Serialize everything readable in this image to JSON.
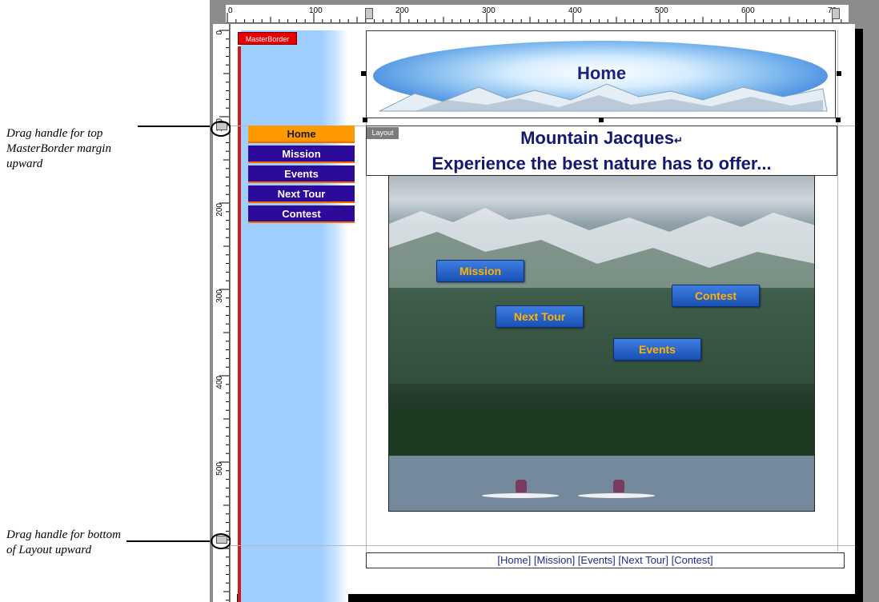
{
  "callouts": [
    {
      "line1": "Drag handle for top",
      "line2": "MasterBorder margin",
      "line3": "upward"
    },
    {
      "line1": "Drag handle for bottom",
      "line2": "of Layout upward"
    }
  ],
  "rulers": {
    "horizontal": [
      "0",
      "100",
      "200",
      "300",
      "400",
      "500",
      "600",
      "70"
    ],
    "vertical": [
      "0",
      "100",
      "200",
      "300",
      "400",
      "500"
    ]
  },
  "tags": {
    "masterborder": "MasterBorder",
    "layout": "Layout"
  },
  "banner": {
    "title": "Home"
  },
  "nav": [
    "Home",
    "Mission",
    "Events",
    "Next Tour",
    "Contest"
  ],
  "headline": {
    "line1": "Mountain Jacques",
    "return_mark": "↵",
    "line2": "Experience the best nature has to offer..."
  },
  "photo_buttons": [
    "Mission",
    "Next Tour",
    "Contest",
    "Events"
  ],
  "footer": {
    "text": "[Home] [Mission] [Events] [Next Tour] [Contest]"
  },
  "colors": {
    "nav_bg": "#2c0a9a",
    "nav_active": "#ff9900",
    "separator": "#ff6a00",
    "masterborder_tag": "#e60000",
    "photo_button_text": "#ffb300"
  }
}
